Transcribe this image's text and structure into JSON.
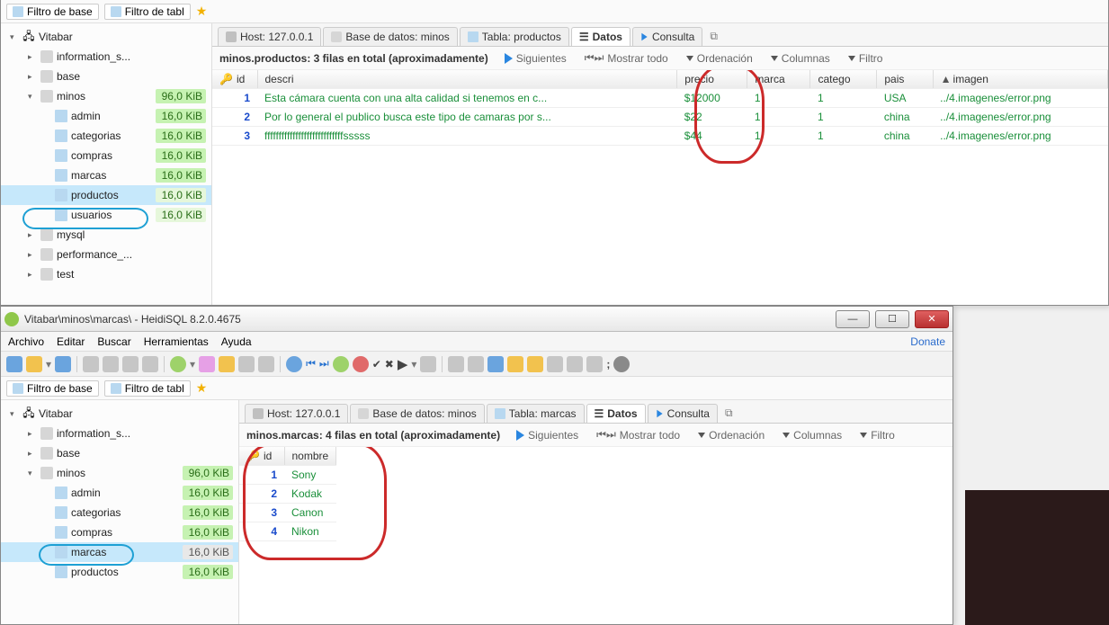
{
  "window1": {
    "filtertabs": [
      "Filtro de base",
      "Filtro de tabl"
    ],
    "connection": "Vitabar",
    "databases": [
      {
        "name": "information_s...",
        "size": null,
        "expanded": false
      },
      {
        "name": "base",
        "size": null,
        "expanded": false
      },
      {
        "name": "minos",
        "size": "96,0 KiB",
        "sizeClass": "green",
        "expanded": true,
        "tables": [
          {
            "name": "admin",
            "size": "16,0 KiB",
            "sizeClass": "green"
          },
          {
            "name": "categorias",
            "size": "16,0 KiB",
            "sizeClass": "green"
          },
          {
            "name": "compras",
            "size": "16,0 KiB",
            "sizeClass": "green"
          },
          {
            "name": "marcas",
            "size": "16,0 KiB",
            "sizeClass": "green"
          },
          {
            "name": "productos",
            "size": "16,0 KiB",
            "sizeClass": "light",
            "selected": true,
            "circled": true
          },
          {
            "name": "usuarios",
            "size": "16,0 KiB",
            "sizeClass": "light"
          }
        ]
      },
      {
        "name": "mysql",
        "size": null,
        "expanded": false
      },
      {
        "name": "performance_...",
        "size": null,
        "expanded": false
      },
      {
        "name": "test",
        "size": null,
        "expanded": false
      }
    ],
    "tabs": [
      {
        "label": "Host: 127.0.0.1",
        "icon": "host"
      },
      {
        "label": "Base de datos: minos",
        "icon": "db"
      },
      {
        "label": "Tabla: productos",
        "icon": "table"
      },
      {
        "label": "Datos",
        "icon": "data",
        "active": true
      },
      {
        "label": "Consulta",
        "icon": "query"
      }
    ],
    "summary": "minos.productos: 3 filas en total (aproximadamente)",
    "actions": {
      "next": "Siguientes",
      "all": "Mostrar todo",
      "sort": "Ordenación",
      "cols": "Columnas",
      "filter": "Filtro"
    },
    "columns": [
      {
        "key": "id",
        "pk": true
      },
      {
        "key": "descri"
      },
      {
        "key": "precio"
      },
      {
        "key": "marca",
        "circled": true
      },
      {
        "key": "catego"
      },
      {
        "key": "pais"
      },
      {
        "key": "imagen",
        "sorted": true
      }
    ],
    "rows": [
      {
        "id": "1",
        "descri": "Esta cámara cuenta con una alta calidad si tenemos en c...",
        "precio": "$12000",
        "marca": "1",
        "catego": "1",
        "pais": "USA",
        "imagen": "../4.imagenes/error.png"
      },
      {
        "id": "2",
        "descri": "Por lo general el publico busca este tipo de camaras por s...",
        "precio": "$22",
        "marca": "1",
        "catego": "1",
        "pais": "china",
        "imagen": "../4.imagenes/error.png"
      },
      {
        "id": "3",
        "descri": "ffffffffffffffffffffffffffffsssss",
        "precio": "$44",
        "marca": "1",
        "catego": "1",
        "pais": "china",
        "imagen": "../4.imagenes/error.png"
      }
    ]
  },
  "window2": {
    "title": "Vitabar\\minos\\marcas\\ - HeidiSQL 8.2.0.4675",
    "menus": [
      "Archivo",
      "Editar",
      "Buscar",
      "Herramientas",
      "Ayuda"
    ],
    "donate": "Donate",
    "filtertabs": [
      "Filtro de base",
      "Filtro de tabl"
    ],
    "connection": "Vitabar",
    "databases": [
      {
        "name": "information_s...",
        "size": null,
        "expanded": false
      },
      {
        "name": "base",
        "size": null,
        "expanded": false
      },
      {
        "name": "minos",
        "size": "96,0 KiB",
        "sizeClass": "green",
        "expanded": true,
        "tables": [
          {
            "name": "admin",
            "size": "16,0 KiB",
            "sizeClass": "green"
          },
          {
            "name": "categorias",
            "size": "16,0 KiB",
            "sizeClass": "green"
          },
          {
            "name": "compras",
            "size": "16,0 KiB",
            "sizeClass": "green"
          },
          {
            "name": "marcas",
            "size": "16,0 KiB",
            "sizeClass": "gray",
            "selected": true,
            "circled": true
          },
          {
            "name": "productos",
            "size": "16,0 KiB",
            "sizeClass": "green"
          }
        ]
      }
    ],
    "tabs": [
      {
        "label": "Host: 127.0.0.1",
        "icon": "host"
      },
      {
        "label": "Base de datos: minos",
        "icon": "db"
      },
      {
        "label": "Tabla: marcas",
        "icon": "table"
      },
      {
        "label": "Datos",
        "icon": "data",
        "active": true
      },
      {
        "label": "Consulta",
        "icon": "query"
      }
    ],
    "summary": "minos.marcas: 4 filas en total (aproximadamente)",
    "actions": {
      "next": "Siguientes",
      "all": "Mostrar todo",
      "sort": "Ordenación",
      "cols": "Columnas",
      "filter": "Filtro"
    },
    "columns": [
      {
        "key": "id",
        "pk": true
      },
      {
        "key": "nombre"
      }
    ],
    "rows": [
      {
        "id": "1",
        "nombre": "Sony"
      },
      {
        "id": "2",
        "nombre": "Kodak"
      },
      {
        "id": "3",
        "nombre": "Canon"
      },
      {
        "id": "4",
        "nombre": "Nikon"
      }
    ]
  }
}
